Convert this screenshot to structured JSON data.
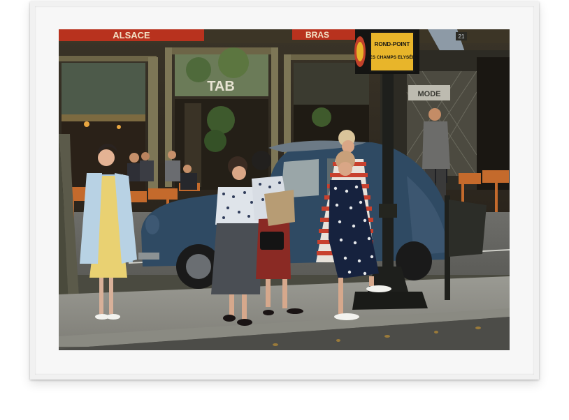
{
  "photo": {
    "awning_left_text": "ALSACE",
    "awning_mid_text": "BRAS",
    "window_letters": "TAB",
    "sign_line1": "ROND-POINT",
    "sign_line2": "DES CHAMPS ELYSÉES",
    "building_number": "21",
    "shop_sign_text": "MODE",
    "colors": {
      "frame": "#f1f1f1",
      "awning": "#b8321e",
      "sign_yellow": "#e8b52a",
      "car": "#2f4a63"
    }
  }
}
